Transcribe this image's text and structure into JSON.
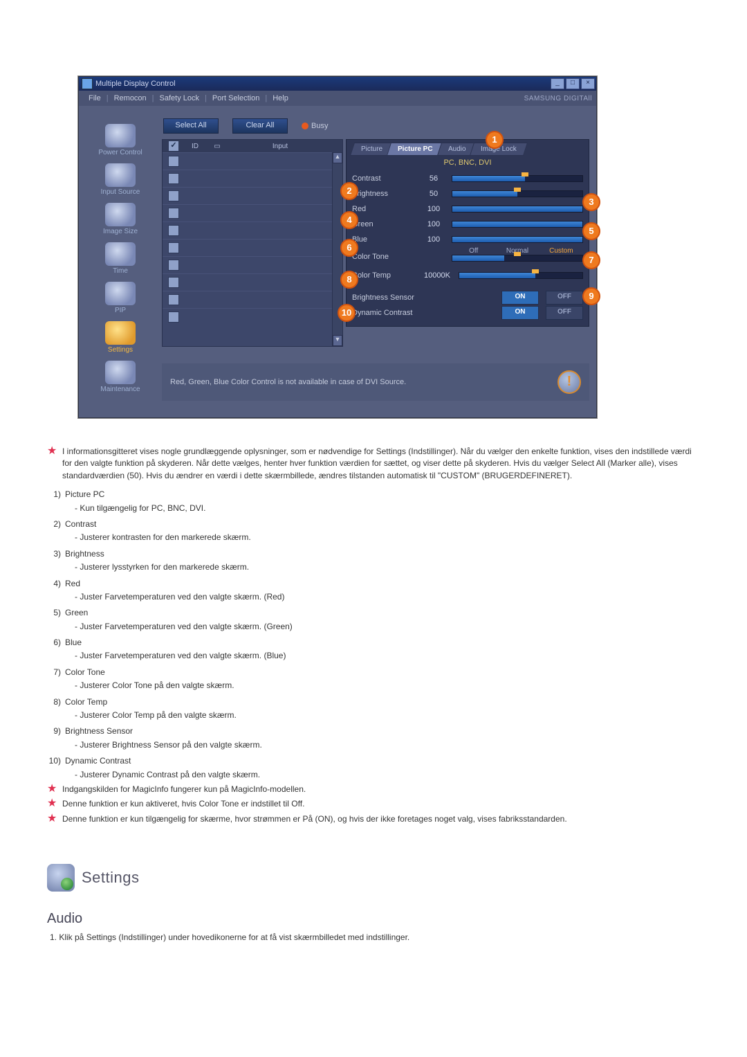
{
  "window": {
    "title": "Multiple Display Control",
    "menu": [
      "File",
      "Remocon",
      "Safety Lock",
      "Port Selection",
      "Help"
    ],
    "brand": "SAMSUNG DIGITAll"
  },
  "sidebar": [
    {
      "label": "Power Control"
    },
    {
      "label": "Input Source"
    },
    {
      "label": "Image Size"
    },
    {
      "label": "Time"
    },
    {
      "label": "PIP"
    },
    {
      "label": "Settings",
      "active": true
    },
    {
      "label": "Maintenance"
    }
  ],
  "toolbar": {
    "select_all": "Select All",
    "clear_all": "Clear All",
    "busy": "Busy"
  },
  "grid": {
    "headers": {
      "id": "ID",
      "input": "Input"
    },
    "row_count": 10,
    "first_checked": true
  },
  "tabs": [
    "Picture",
    "Picture PC",
    "Audio",
    "Image Lock"
  ],
  "tabs_active": 1,
  "mode_label": "PC, BNC, DVI",
  "sliders": {
    "contrast": {
      "label": "Contrast",
      "value": "56"
    },
    "brightness": {
      "label": "Brightness",
      "value": "50"
    },
    "red": {
      "label": "Red",
      "value": "100"
    },
    "green": {
      "label": "Green",
      "value": "100"
    },
    "blue": {
      "label": "Blue",
      "value": "100"
    }
  },
  "color_tone": {
    "label": "Color Tone",
    "options": [
      "Off",
      "Normal",
      "Custom"
    ]
  },
  "color_temp": {
    "label": "Color Temp",
    "value": "10000K"
  },
  "brightness_sensor": {
    "label": "Brightness Sensor",
    "on": "ON",
    "off": "OFF"
  },
  "dynamic_contrast": {
    "label": "Dynamic Contrast",
    "on": "ON",
    "off": "OFF"
  },
  "callouts": [
    "1",
    "2",
    "3",
    "4",
    "5",
    "6",
    "7",
    "8",
    "9",
    "10"
  ],
  "footer_note": "Red, Green, Blue Color Control is not available in case of DVI Source.",
  "intro_para": "I informationsgitteret vises nogle grundlæggende oplysninger, som er nødvendige for Settings (Indstillinger). Når du vælger den enkelte funktion, vises den indstillede værdi for den valgte funktion på skyderen. Når dette vælges, henter hver funktion værdien for sættet, og viser dette på skyderen. Hvis du vælger Select All (Marker alle), vises standardværdien (50). Hvis du ændrer en værdi i dette skærmbillede, ændres tilstanden automatisk til \"CUSTOM\" (BRUGERDEFINERET).",
  "items": [
    {
      "n": "1)",
      "t": "Picture PC",
      "d": "- Kun tilgængelig for PC, BNC, DVI."
    },
    {
      "n": "2)",
      "t": "Contrast",
      "d": "- Justerer kontrasten for den markerede skærm."
    },
    {
      "n": "3)",
      "t": "Brightness",
      "d": "- Justerer lysstyrken for den markerede skærm."
    },
    {
      "n": "4)",
      "t": "Red",
      "d": "- Juster Farvetemperaturen ved den valgte skærm. (Red)"
    },
    {
      "n": "5)",
      "t": "Green",
      "d": "- Juster Farvetemperaturen ved den valgte skærm. (Green)"
    },
    {
      "n": "6)",
      "t": "Blue",
      "d": "- Juster Farvetemperaturen ved den valgte skærm. (Blue)"
    },
    {
      "n": "7)",
      "t": "Color Tone",
      "d": "- Justerer Color Tone på den valgte skærm."
    },
    {
      "n": "8)",
      "t": "Color Temp",
      "d": "- Justerer Color Temp på den valgte skærm."
    },
    {
      "n": "9)",
      "t": "Brightness Sensor",
      "d": "- Justerer Brightness Sensor på den valgte skærm."
    },
    {
      "n": "10)",
      "t": "Dynamic Contrast",
      "d": "- Justerer Dynamic Contrast på den valgte skærm."
    }
  ],
  "notes": [
    "Indgangskilden for MagicInfo fungerer kun på MagicInfo-modellen.",
    "Denne funktion er kun aktiveret, hvis Color Tone er indstillet til Off.",
    "Denne funktion er kun tilgængelig for skærme, hvor strømmen er På (ON), og hvis der ikke foretages noget valg, vises fabriksstandarden."
  ],
  "section": {
    "title": "Settings",
    "sub": "Audio",
    "step": "1. Klik på Settings (Indstillinger) under hovedikonerne for at få vist skærmbilledet med indstillinger."
  }
}
